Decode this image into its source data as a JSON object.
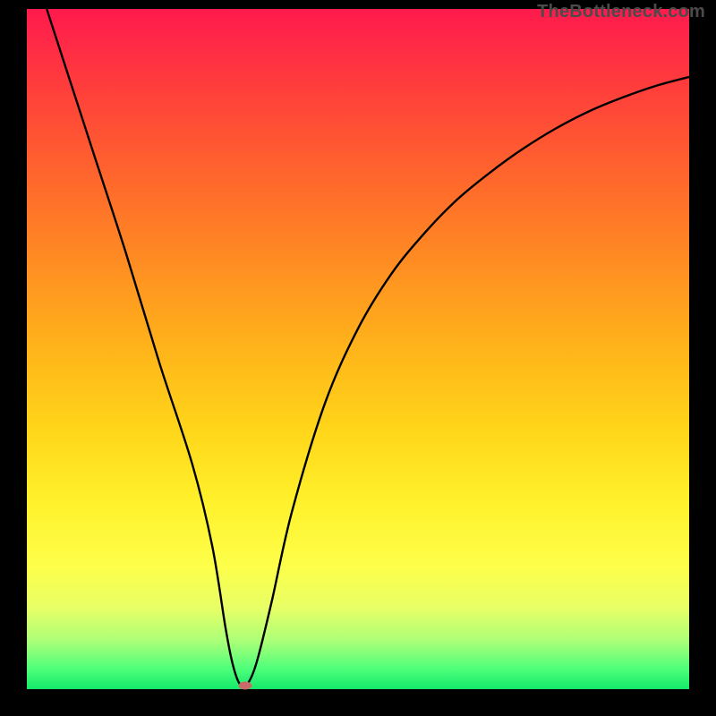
{
  "watermark": "TheBottleneck.com",
  "chart_data": {
    "type": "line",
    "title": "",
    "xlabel": "",
    "ylabel": "",
    "xlim": [
      0,
      100
    ],
    "ylim": [
      0,
      100
    ],
    "series": [
      {
        "name": "curve",
        "x": [
          3,
          5,
          10,
          15,
          20,
          25,
          28,
          30,
          31,
          32,
          33,
          34,
          35,
          37,
          40,
          45,
          50,
          55,
          60,
          65,
          70,
          75,
          80,
          85,
          90,
          95,
          100
        ],
        "y": [
          100,
          94,
          79,
          64,
          48,
          33,
          21,
          9,
          4,
          1,
          0.5,
          2,
          5,
          13,
          26,
          42,
          53,
          61,
          67,
          72,
          76,
          79.5,
          82.5,
          85,
          87,
          88.7,
          90
        ]
      }
    ],
    "marker": {
      "x": 33,
      "y": 0.5,
      "color": "#c86a6a"
    },
    "curve_stroke": "#000000"
  }
}
